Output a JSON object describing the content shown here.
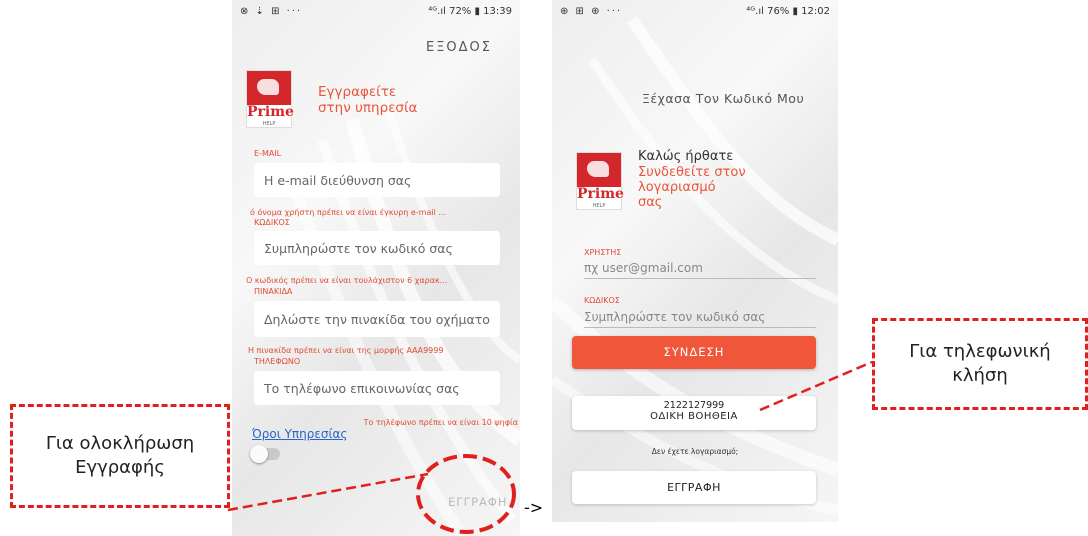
{
  "screen1": {
    "status_left": "⊗ ⇣ ⊞ ···",
    "status_right": "⁴ᴳ.ıl 72% ▮ 13:39",
    "exit_label": "ΕΞΟΔΟΣ",
    "logo_word": "Prime",
    "logo_sub": "HELP",
    "heading_line1": "Εγγραφείτε",
    "heading_line2": "στην υπηρεσία",
    "email_label": "E-MAIL",
    "email_placeholder": "Η e-mail διεύθυνση σας",
    "email_error": "ό όνομα χρήστη πρέπει να είναι έγκυρη e-mail ...",
    "password_label": "ΚΩΔΙΚΟΣ",
    "password_placeholder": "Συμπληρώστε τον κωδικό σας",
    "password_error": "Ο κωδικός πρέπει να είναι τουλάχιστον 6 χαρακ...",
    "plate_label": "ΠΙΝΑΚΙΔΑ",
    "plate_placeholder": "Δηλώστε την πινακίδα του οχήματο",
    "plate_error": "Η πινακίδα πρέπει να είναι της μορφής ΑΑΑ9999",
    "phone_label": "ΤΗΛΕΦΩΝΟ",
    "phone_placeholder": "Το τηλέφωνο επικοινωνίας σας",
    "phone_error": "Το τηλέφωνο πρέπει να είναι 10 ψηφία",
    "terms_link": "Όροι Υπηρεσίας",
    "register_button": "ΕΓΓΡΑΦΗ"
  },
  "screen2": {
    "status_left": "⊕ ⊞ ⊕ ···",
    "status_right": "⁴ᴳ.ıl 76% ▮ 12:02",
    "forgot_password": "Ξέχασα Τον Κωδικό Μου",
    "logo_word": "Prime",
    "logo_sub": "HELP",
    "welcome": "Καλώς ήρθατε",
    "subtitle_line1": "Συνδεθείτε στον",
    "subtitle_line2": "λογαριασμό",
    "subtitle_line3": "σας",
    "user_label": "ΧΡΗΣΤΗΣ",
    "user_placeholder": "πχ user@gmail.com",
    "password_label": "ΚΩΔΙΚΟΣ",
    "password_placeholder": "Συμπληρώστε τον κωδικό σας",
    "login_button": "ΣΥΝΔΕΣΗ",
    "help_phone": "2122127999",
    "help_label": "ΟΔΙΚΗ ΒΟΗΘΕΙΑ",
    "no_account": "Δεν έχετε λογαριασμό;",
    "register_button": "ΕΓΓΡΑΦΗ"
  },
  "annotations": {
    "complete_registration": "Για ολοκλήρωση Εγγραφής",
    "phone_call": "Για τηλεφωνική κλήση",
    "arrow": "->"
  },
  "colors": {
    "accent_red": "#e8563a",
    "annotation_red": "#e0201f",
    "link_blue": "#2a64c8"
  }
}
